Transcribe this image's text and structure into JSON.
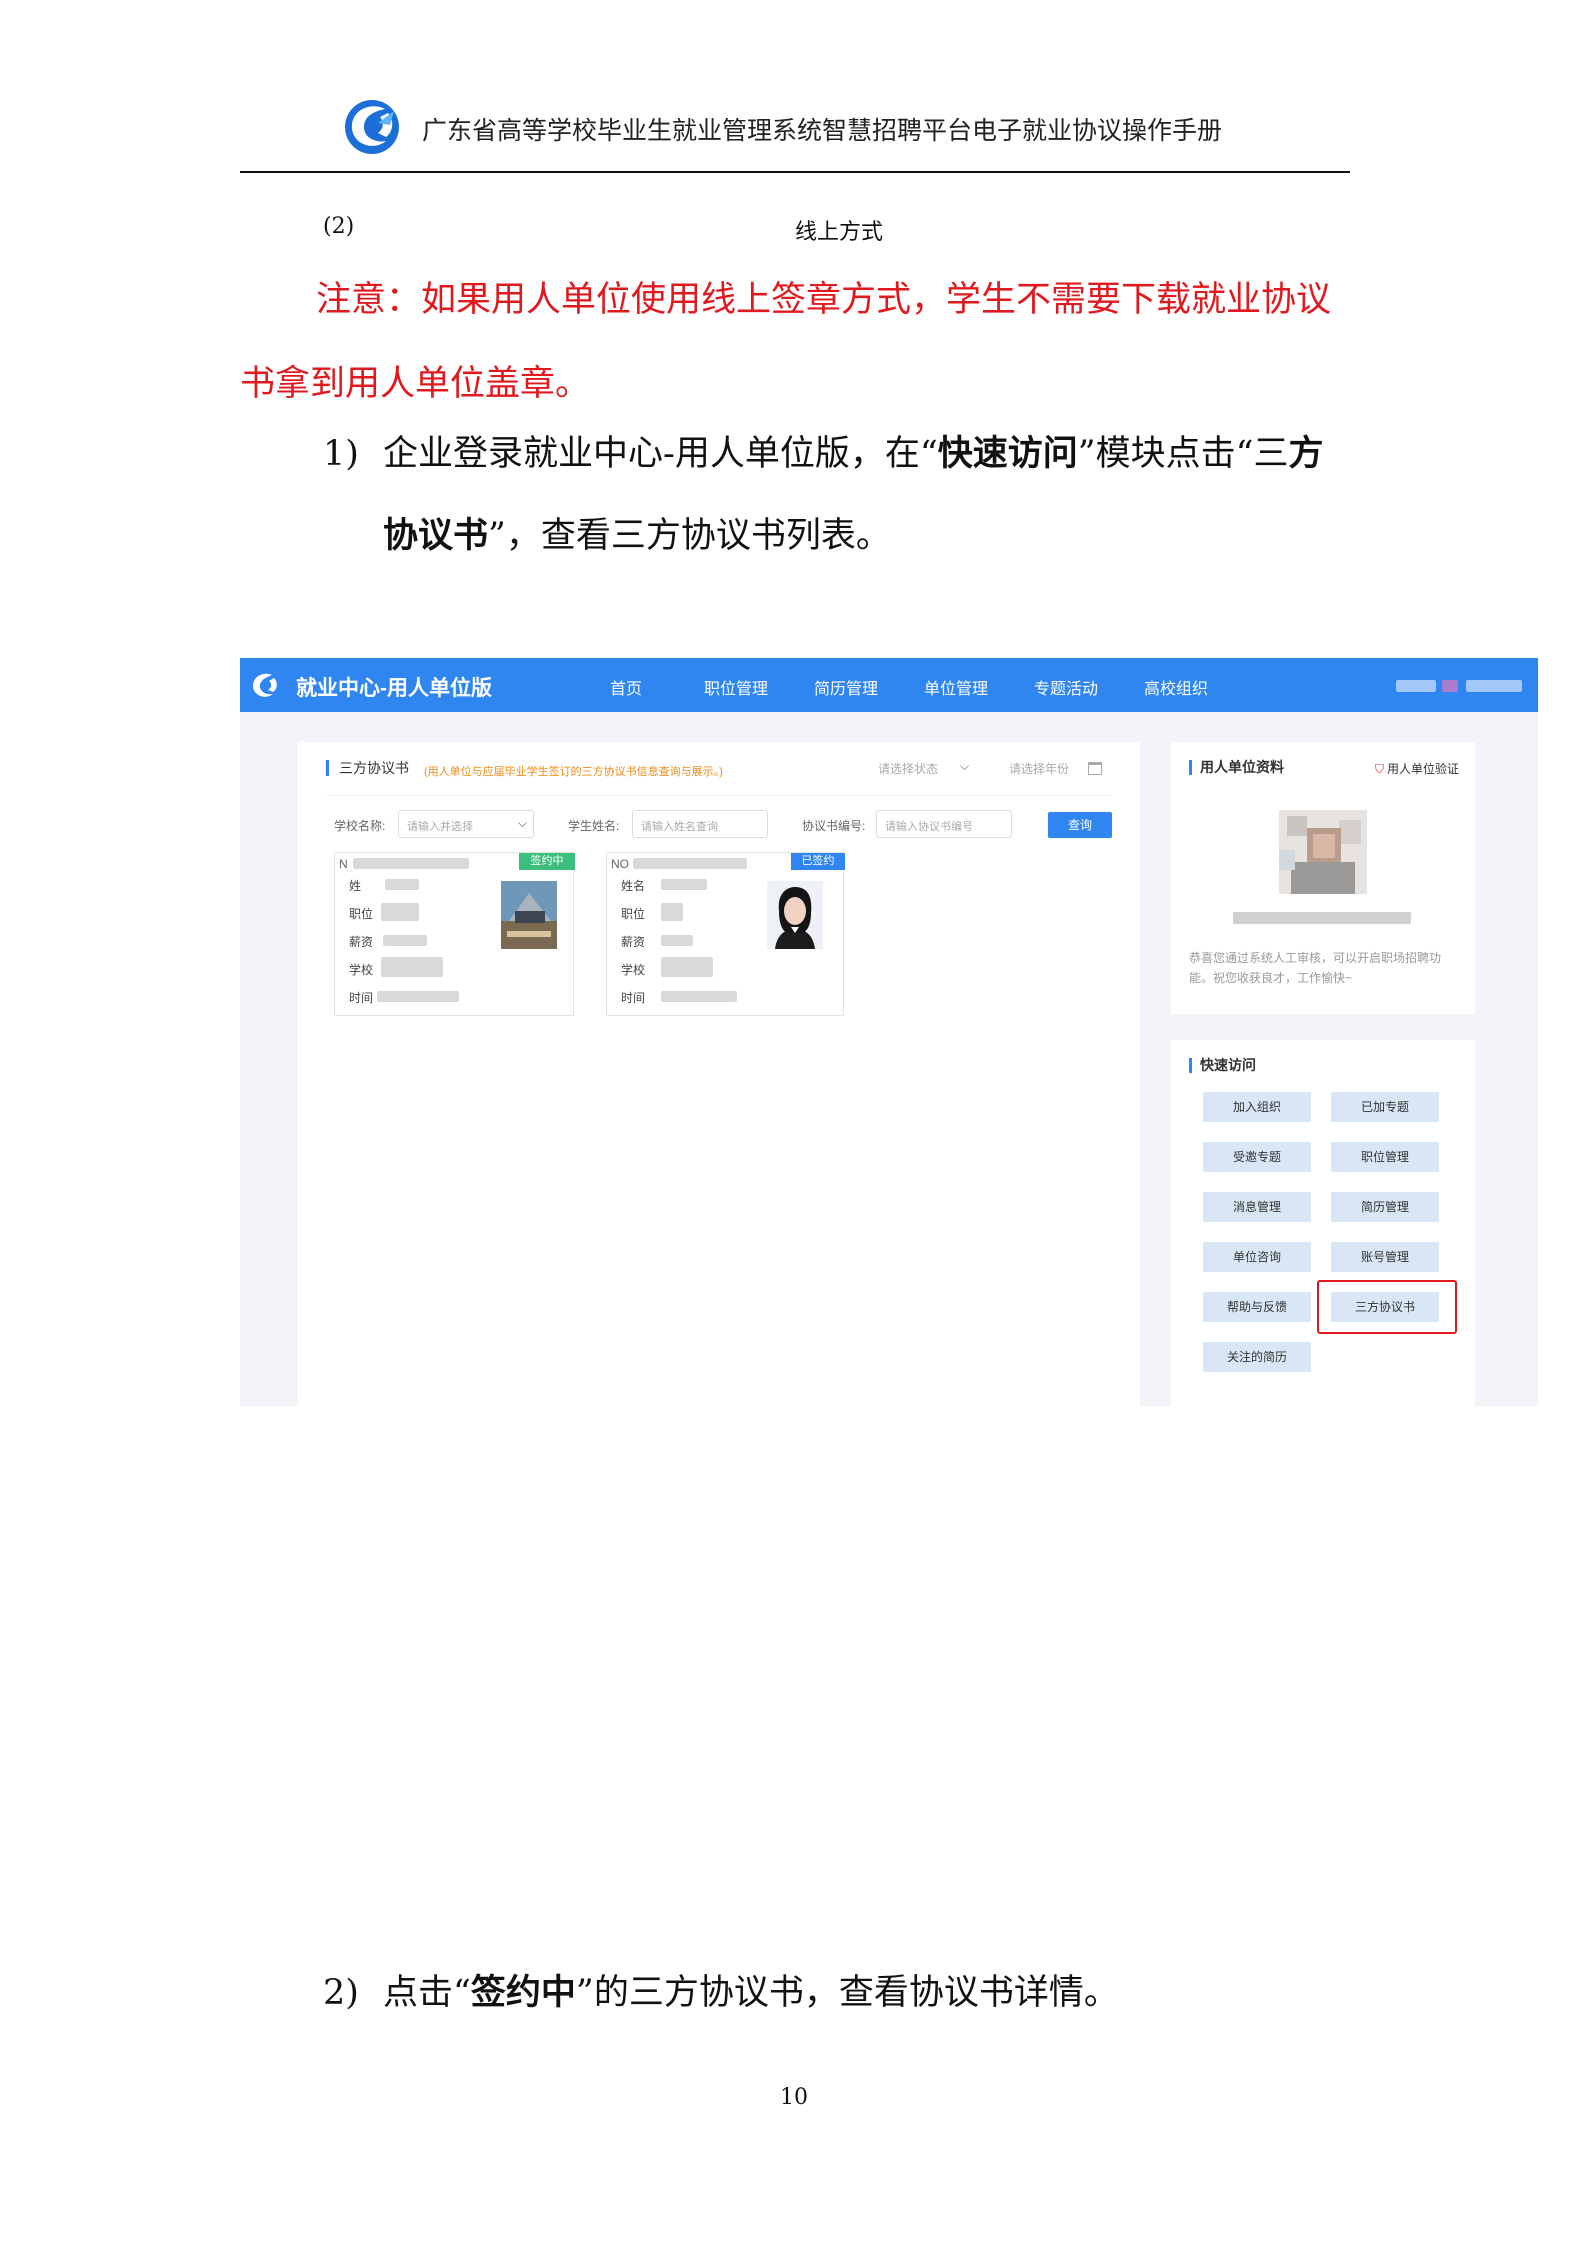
{
  "header": {
    "title": "广东省高等学校毕业生就业管理系统智慧招聘平台电子就业协议操作手册"
  },
  "section": {
    "number": "(2)",
    "title": "线上方式"
  },
  "notice": "注意：如果用人单位使用线上签章方式，学生不需要下载就业协议书拿到用人单位盖章。",
  "step1": {
    "num": "1)",
    "pre": "企业登录就业中心-用人单位版，在“",
    "bold1": "快速访问",
    "mid": "”模块点击“三",
    "bold2": "方协议书",
    "post": "”，查看三方协议书列表。"
  },
  "screenshot": {
    "brand": "就业中心-用人单位版",
    "nav": [
      "首页",
      "职位管理",
      "简历管理",
      "单位管理",
      "专题活动",
      "高校组织"
    ],
    "panel_title": "三方协议书",
    "panel_note": "(用人单位与应届毕业学生签订的三方协议书信息查询与展示。)",
    "status_placeholder": "请选择状态",
    "year_placeholder": "请选择年份",
    "filters": {
      "school_label": "学校名称:",
      "school_placeholder": "请输入并选择",
      "student_label": "学生姓名:",
      "student_placeholder": "请输入姓名查询",
      "agreement_label": "协议书编号:",
      "agreement_placeholder": "请输入协议书编号",
      "query_button": "查询"
    },
    "cards": [
      {
        "no": "N",
        "badge": "签约中",
        "rows": [
          "姓",
          "职位",
          "薪资",
          "学校",
          "时间"
        ]
      },
      {
        "no": "NO",
        "badge": "已签约",
        "rows": [
          "姓名",
          "职位",
          "薪资",
          "学校",
          "时间"
        ]
      }
    ],
    "side": {
      "title": "用人单位资料",
      "verify": "用人单位验证",
      "desc": "恭喜您通过系统人工审核，可以开启职场招聘功能。祝您收获良才，工作愉快~"
    },
    "quick_access": {
      "title": "快速访问",
      "buttons": [
        "加入组织",
        "已加专题",
        "受邀专题",
        "职位管理",
        "消息管理",
        "简历管理",
        "单位咨询",
        "账号管理",
        "帮助与反馈",
        "三方协议书",
        "关注的简历"
      ]
    }
  },
  "step2": {
    "num": "2)",
    "pre": "点击“",
    "bold": "签约中",
    "post": "”的三方协议书，查看协议书详情。"
  },
  "page_number": "10",
  "colors": {
    "nav_blue": "#2f86f0",
    "notice_red": "#e0191f",
    "badge_green": "#3cbf7c",
    "badge_orange": "#f08a16"
  }
}
